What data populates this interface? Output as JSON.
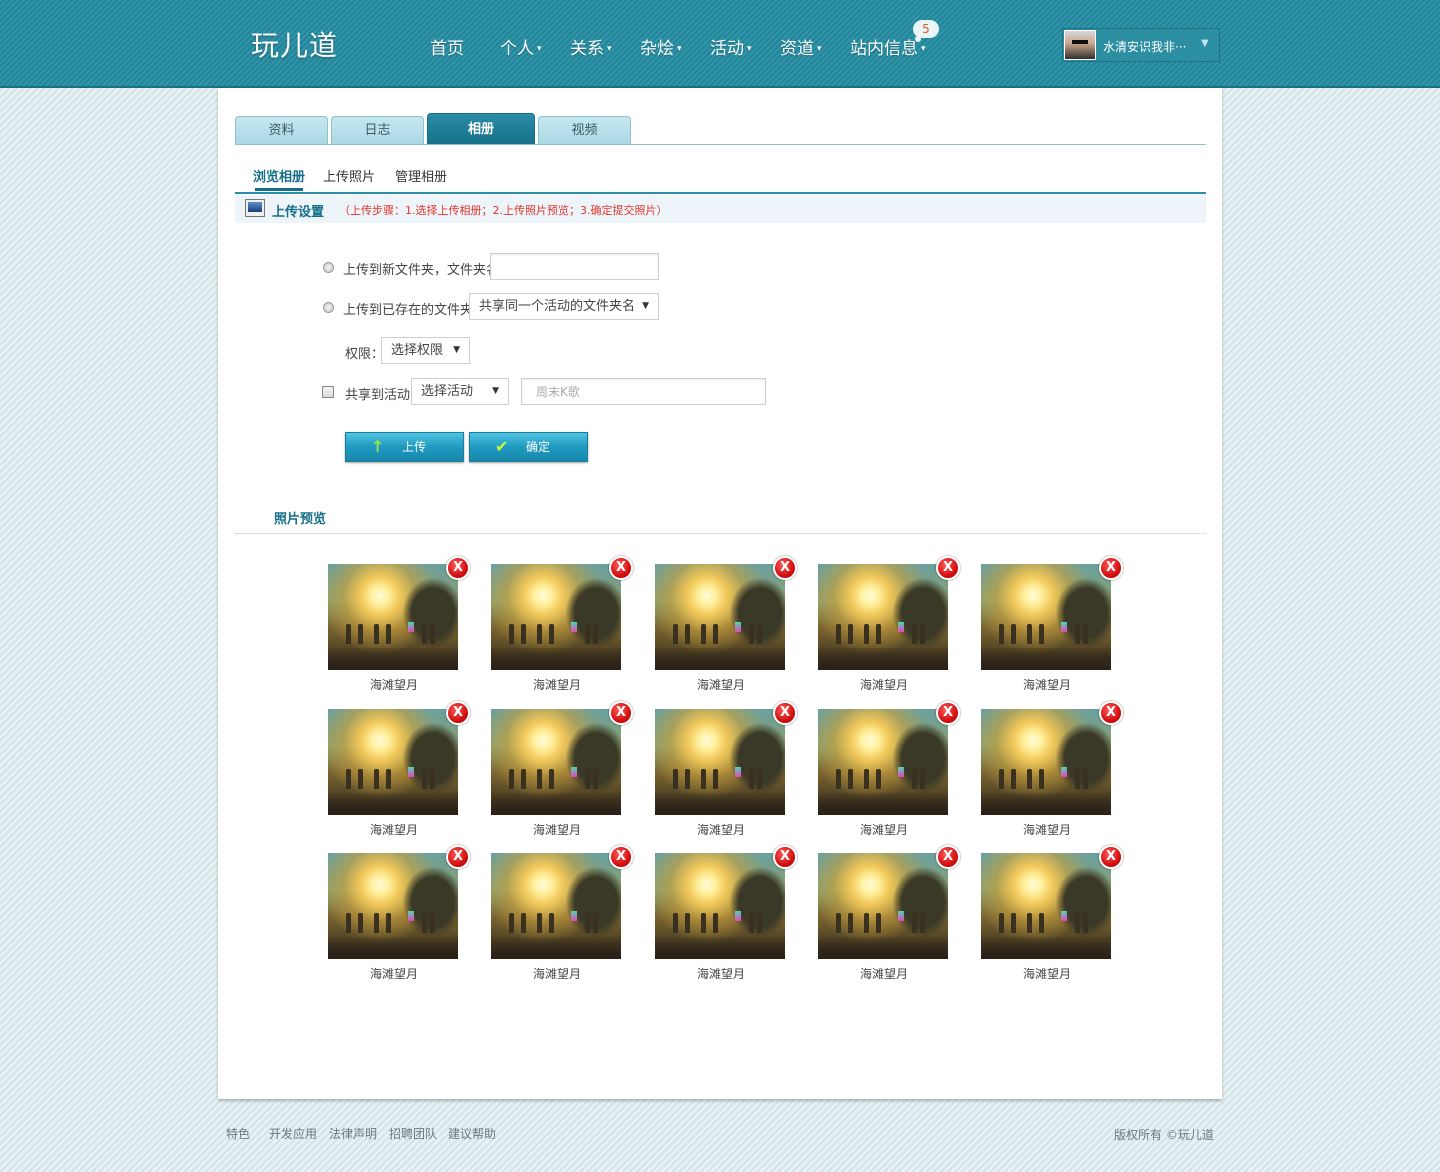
{
  "header": {
    "logo": "玩儿道",
    "nav": [
      {
        "label": "首页",
        "caret": ""
      },
      {
        "label": "个人",
        "caret": "▾"
      },
      {
        "label": "关系",
        "caret": "▾"
      },
      {
        "label": "杂烩",
        "caret": "▾"
      },
      {
        "label": "活动",
        "caret": "▾"
      },
      {
        "label": "资道",
        "caret": "▾"
      },
      {
        "label": "站内信息",
        "caret": "▾"
      }
    ],
    "message_count": "5",
    "user": {
      "name": "水清安识我非···",
      "caret": "▼"
    }
  },
  "tabs": [
    "资料",
    "日志",
    "相册",
    "视频"
  ],
  "active_tab": "相册",
  "subtabs": [
    "浏览相册",
    "上传照片",
    "管理相册"
  ],
  "active_subtab": "浏览相册",
  "upload_settings": {
    "title": "上传设置",
    "steps": "（上传步骤：1.选择上传相册；2.上传照片预览；3.确定提交照片）"
  },
  "form": {
    "new_folder_label": "上传到新文件夹，文件夹名",
    "new_folder_value": "",
    "existing_folder_label": "上传到已存在的文件夹",
    "existing_folder_selected": "共享同一个活动的文件夹名",
    "permission_label": "权限：",
    "permission_selected": "选择权限",
    "share_label": "共享到活动",
    "activity_selected": "选择活动",
    "activity_placeholder": "周末K歌",
    "select_arrow": "▼",
    "upload_button": "上传",
    "confirm_button": "确定",
    "upload_icon": "↑",
    "confirm_icon": "✔"
  },
  "preview": {
    "title": "照片预览",
    "delete_icon": "X",
    "photos": [
      "海滩望月",
      "海滩望月",
      "海滩望月",
      "海滩望月",
      "海滩望月",
      "海滩望月",
      "海滩望月",
      "海滩望月",
      "海滩望月",
      "海滩望月",
      "海滩望月",
      "海滩望月",
      "海滩望月",
      "海滩望月",
      "海滩望月"
    ]
  },
  "footer": {
    "links": [
      "特色",
      "开发应用",
      "法律声明",
      "招聘团队",
      "建议帮助"
    ],
    "copyright": "版权所有 ©玩儿道"
  },
  "colors": {
    "header": "#2a8da0",
    "accent": "#166f88",
    "steps_text": "#e0352b",
    "button": "#1f9ac0",
    "delete_badge": "#d31010"
  }
}
